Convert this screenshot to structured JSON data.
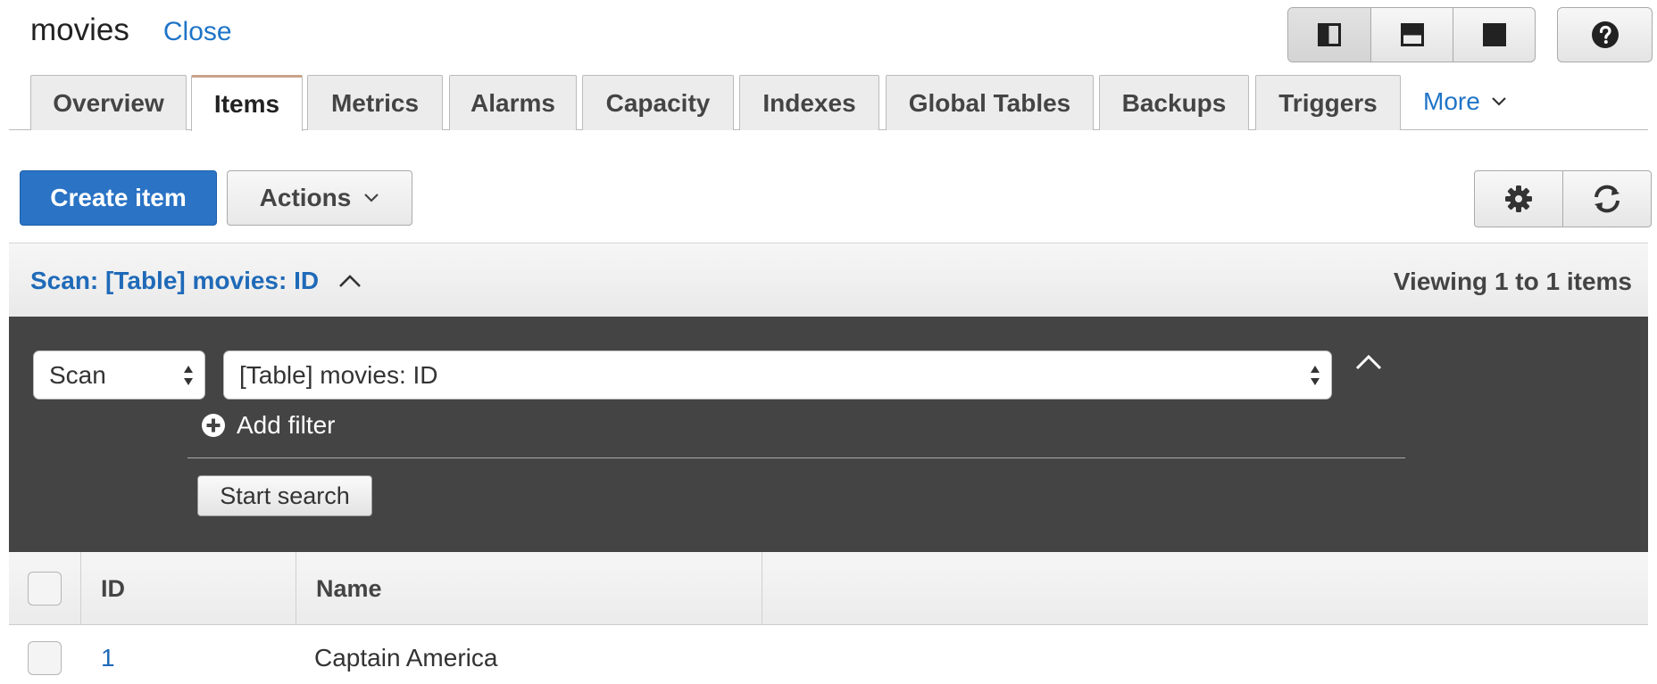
{
  "header": {
    "title": "movies",
    "close_label": "Close"
  },
  "view_controls": [
    "split-left-view-icon",
    "split-bottom-view-icon",
    "full-view-icon"
  ],
  "help_icon": "help-icon",
  "tabs": [
    {
      "label": "Overview",
      "active": false
    },
    {
      "label": "Items",
      "active": true
    },
    {
      "label": "Metrics",
      "active": false
    },
    {
      "label": "Alarms",
      "active": false
    },
    {
      "label": "Capacity",
      "active": false
    },
    {
      "label": "Indexes",
      "active": false
    },
    {
      "label": "Global Tables",
      "active": false
    },
    {
      "label": "Backups",
      "active": false
    },
    {
      "label": "Triggers",
      "active": false
    }
  ],
  "more_tab": {
    "label": "More"
  },
  "toolbar": {
    "create_label": "Create item",
    "actions_label": "Actions"
  },
  "scan": {
    "title": "Scan: [Table] movies: ID",
    "viewing": "Viewing 1 to 1 items",
    "mode": "Scan",
    "target": "[Table] movies: ID",
    "add_filter": "Add filter",
    "start_search": "Start search"
  },
  "table": {
    "columns": [
      "ID",
      "Name"
    ],
    "rows": [
      {
        "id": "1",
        "name": "Captain America"
      }
    ]
  },
  "colors": {
    "accent": "#2a73c5",
    "link": "#1f74c7",
    "panel": "#444444"
  }
}
